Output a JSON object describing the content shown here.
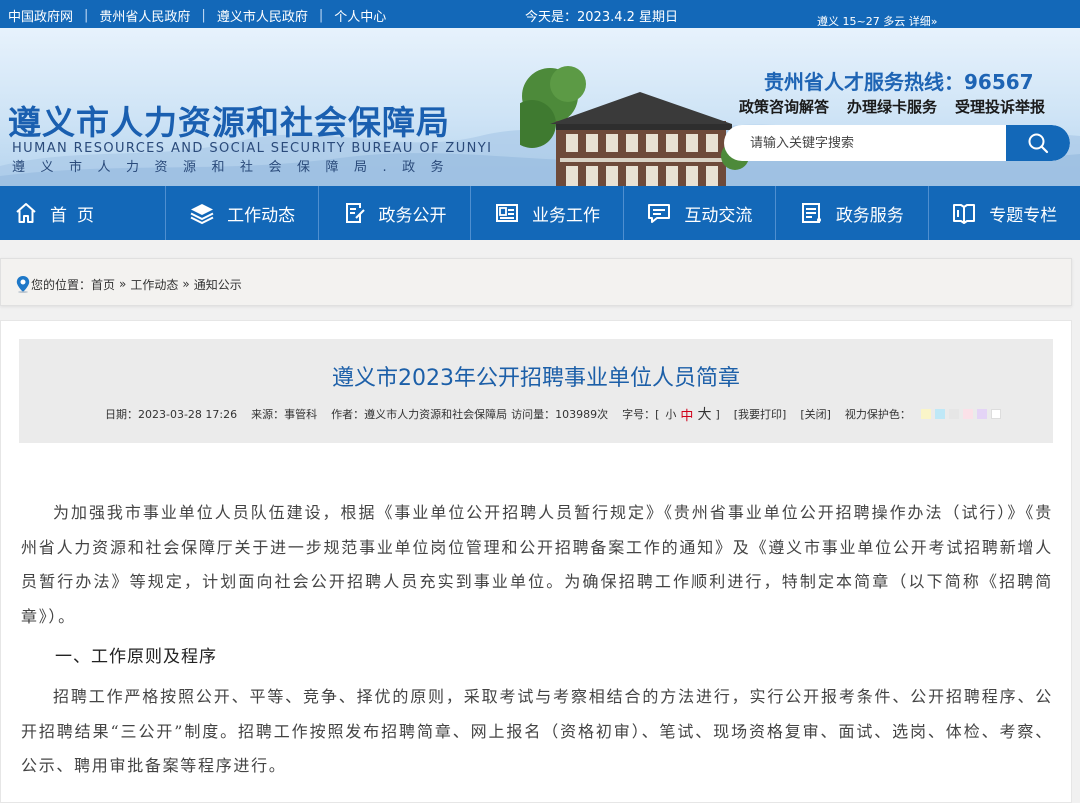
{
  "topbar": {
    "links": [
      "中国政府网",
      "贵州省人民政府",
      "遵义市人民政府",
      "个人中心"
    ],
    "separator": "|",
    "today": "今天是：2023.4.2  星期日",
    "weather": "遵义 15~27 多云 详细»"
  },
  "header": {
    "title": "遵义市人力资源和社会保障局",
    "title_en": "HUMAN RESOURCES AND SOCIAL SECURITY BUREAU OF ZUNYI",
    "title_sub": "遵义市人力资源和社会保障局.政务",
    "hotline": "贵州省人才服务热线：96567",
    "services": [
      "政策咨询解答",
      "办理绿卡服务",
      "受理投诉举报"
    ],
    "search_placeholder": "请输入关键字搜索"
  },
  "nav": {
    "items": [
      "首页",
      "工作动态",
      "政务公开",
      "业务工作",
      "互动交流",
      "政务服务",
      "专题专栏"
    ],
    "icons": [
      "home-icon",
      "layers-icon",
      "document-edit-icon",
      "id-card-icon",
      "chat-icon",
      "service-list-icon",
      "book-icon"
    ]
  },
  "breadcrumb": {
    "prefix": "您的位置：",
    "items": [
      "首页",
      "工作动态",
      "通知公示"
    ],
    "arrow": "»",
    "icon": "location-pin-icon"
  },
  "article": {
    "title": "遵义市2023年公开招聘事业单位人员简章",
    "date": "日期：2023-03-28 17:26",
    "source": "来源：事管科",
    "author": "作者：遵义市人力资源和社会保障局",
    "views": "访问量：103989次",
    "font_label": "字号：[",
    "font_small": "小",
    "font_mid": "中",
    "font_large": "大",
    "font_close": "]",
    "print": "[我要打印]",
    "close": "[关闭]",
    "eye_label": "视力保护色：",
    "eye_colors": [
      "#faf5c8",
      "#bfe8f7",
      "#e6e6e6",
      "#fbe1e8",
      "#e4d4f6",
      "#ffffff"
    ],
    "paragraphs": [
      "为加强我市事业单位人员队伍建设，根据《事业单位公开招聘人员暂行规定》《贵州省事业单位公开招聘操作办法（试行）》《贵州省人力资源和社会保障厅关于进一步规范事业单位岗位管理和公开招聘备案工作的通知》及《遵义市事业单位公开考试招聘新增人员暂行办法》等规定，计划面向社会公开招聘人员充实到事业单位。为确保招聘工作顺利进行，特制定本简章（以下简称《招聘简章》）。"
    ],
    "section1_heading": "一、工作原则及程序",
    "section1_text": "招聘工作严格按照公开、平等、竞争、择优的原则，采取考试与考察相结合的方法进行，实行公开报考条件、公开招聘程序、公开招聘结果“三公开”制度。招聘工作按照发布招聘简章、网上报名（资格初审）、笔试、现场资格复审、面试、选岗、体检、考察、公示、聘用审批备案等程序进行。"
  },
  "colors": {
    "brand_blue": "#1368b8",
    "title_blue": "#1c5fa8",
    "highlight_red": "#d0021b"
  }
}
